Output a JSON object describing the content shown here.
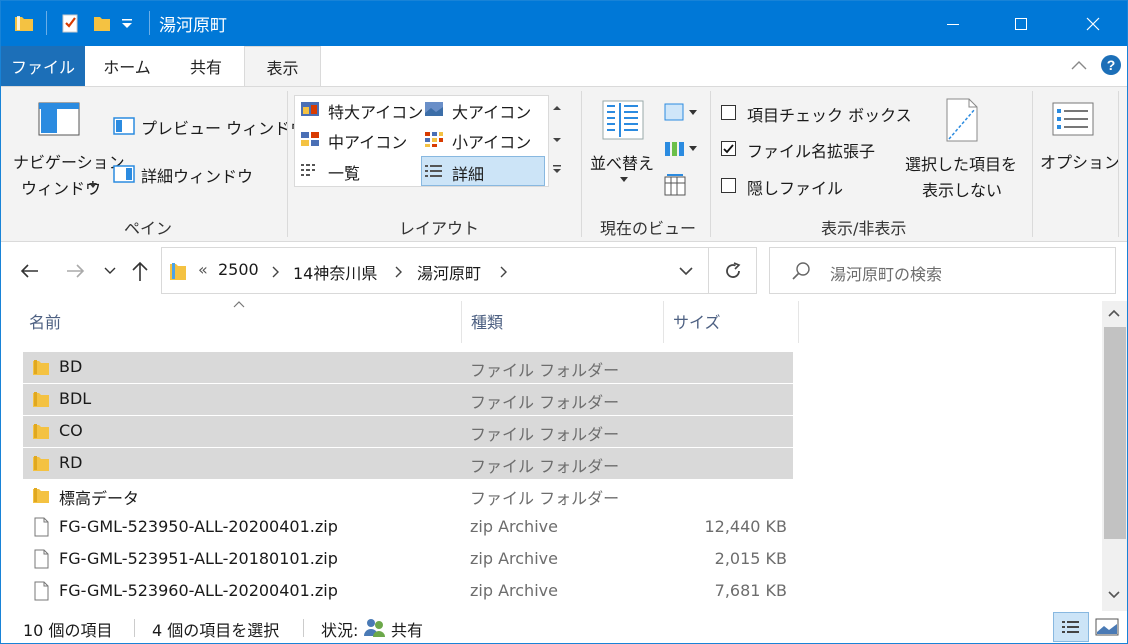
{
  "window": {
    "title": "湯河原町",
    "minimize_icon": "minimize-icon",
    "maximize_icon": "maximize-icon",
    "close_icon": "close-icon"
  },
  "ribbon_tabs": {
    "file": "ファイル",
    "home": "ホーム",
    "share": "共有",
    "view": "表示",
    "active": "表示"
  },
  "ribbon": {
    "pane_group": {
      "label": "ペイン",
      "nav_pane_line1": "ナビゲーション",
      "nav_pane_line2": "ウィンドウ",
      "preview": "プレビュー ウィンドウ",
      "details": "詳細ウィンドウ"
    },
    "layout_group": {
      "label": "レイアウト",
      "items": [
        "特大アイコン",
        "大アイコン",
        "中アイコン",
        "小アイコン",
        "一覧",
        "詳細"
      ],
      "selected": "詳細"
    },
    "current_view_group": {
      "label": "現在のビュー",
      "sort": "並べ替え"
    },
    "show_hide_group": {
      "label": "表示/非表示",
      "item_checkboxes": {
        "label": "項目チェック ボックス",
        "checked": false
      },
      "file_extensions": {
        "label": "ファイル名拡張子",
        "checked": true
      },
      "hidden_files": {
        "label": "隠しファイル",
        "checked": false
      },
      "hide_selected_line1": "選択した項目を",
      "hide_selected_line2": "表示しない"
    },
    "options": "オプション"
  },
  "address": {
    "overflow": "«",
    "breadcrumbs": [
      "2500",
      "14神奈川県",
      "湯河原町"
    ],
    "search_placeholder": "湯河原町の検索"
  },
  "columns": {
    "name": "名前",
    "type": "種類",
    "size": "サイズ"
  },
  "files": [
    {
      "name": "BD",
      "type": "ファイル フォルダー",
      "size": "",
      "kind": "folder",
      "selected": true
    },
    {
      "name": "BDL",
      "type": "ファイル フォルダー",
      "size": "",
      "kind": "folder",
      "selected": true
    },
    {
      "name": "CO",
      "type": "ファイル フォルダー",
      "size": "",
      "kind": "folder",
      "selected": true
    },
    {
      "name": "RD",
      "type": "ファイル フォルダー",
      "size": "",
      "kind": "folder",
      "selected": true
    },
    {
      "name": "標高データ",
      "type": "ファイル フォルダー",
      "size": "",
      "kind": "folder",
      "selected": false
    },
    {
      "name": "FG-GML-523950-ALL-20200401.zip",
      "type": "zip Archive",
      "size": "12,440 KB",
      "kind": "file",
      "selected": false
    },
    {
      "name": "FG-GML-523951-ALL-20180101.zip",
      "type": "zip Archive",
      "size": "2,015 KB",
      "kind": "file",
      "selected": false
    },
    {
      "name": "FG-GML-523960-ALL-20200401.zip",
      "type": "zip Archive",
      "size": "7,681 KB",
      "kind": "file",
      "selected": false
    }
  ],
  "status": {
    "count": "10 個の項目",
    "selected": "4 個の項目を選択",
    "state_label": "状況:",
    "state_value": "共有"
  },
  "colors": {
    "accent": "#0078d7",
    "file_tab": "#1c6fb8",
    "selection": "#d9d9d9",
    "folder": "#f4c242"
  }
}
